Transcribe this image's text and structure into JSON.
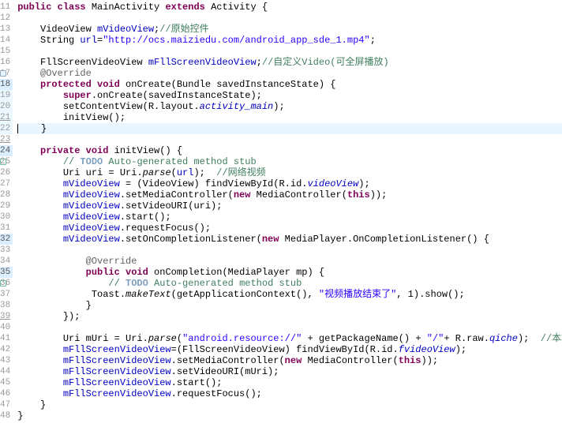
{
  "editor": {
    "first_line": 11,
    "last_line": 48,
    "highlighted_line": 22,
    "lines": {
      "11": [
        {
          "cls": "kw",
          "t": "public class"
        },
        {
          "cls": "plain",
          "t": " MainActivity "
        },
        {
          "cls": "kw",
          "t": "extends"
        },
        {
          "cls": "plain",
          "t": " Activity {"
        }
      ],
      "12": [
        {
          "cls": "plain",
          "t": ""
        }
      ],
      "13": [
        {
          "cls": "plain",
          "t": "    VideoView "
        },
        {
          "cls": "field",
          "t": "mVideoView"
        },
        {
          "cls": "plain",
          "t": ";"
        },
        {
          "cls": "cmt",
          "t": "//原始控件"
        }
      ],
      "14": [
        {
          "cls": "plain",
          "t": "    String "
        },
        {
          "cls": "field",
          "t": "url"
        },
        {
          "cls": "plain",
          "t": "="
        },
        {
          "cls": "str",
          "t": "\"http://ocs.maiziedu.com/android_app_sde_1.mp4\""
        },
        {
          "cls": "plain",
          "t": ";"
        }
      ],
      "15": [
        {
          "cls": "plain",
          "t": ""
        }
      ],
      "16": [
        {
          "cls": "plain",
          "t": "    FllScreenVideoView "
        },
        {
          "cls": "field",
          "t": "mFllScreenVideoView"
        },
        {
          "cls": "plain",
          "t": ";"
        },
        {
          "cls": "cmt",
          "t": "//自定义Video(可全屏播放)"
        }
      ],
      "17": [
        {
          "cls": "ann",
          "t": "    @Override"
        }
      ],
      "18": [
        {
          "cls": "plain",
          "t": "    "
        },
        {
          "cls": "kw",
          "t": "protected void"
        },
        {
          "cls": "plain",
          "t": " onCreate(Bundle savedInstanceState) {"
        }
      ],
      "19": [
        {
          "cls": "plain",
          "t": "        "
        },
        {
          "cls": "kw",
          "t": "super"
        },
        {
          "cls": "plain",
          "t": ".onCreate(savedInstanceState);"
        }
      ],
      "20": [
        {
          "cls": "plain",
          "t": "        setContentView(R.layout."
        },
        {
          "cls": "const-it",
          "t": "activity_main"
        },
        {
          "cls": "plain",
          "t": ");"
        }
      ],
      "21": [
        {
          "cls": "plain",
          "t": "        initView();"
        }
      ],
      "22": [
        {
          "cls": "plain",
          "t": "    }"
        }
      ],
      "23": [
        {
          "cls": "plain",
          "t": ""
        }
      ],
      "24": [
        {
          "cls": "plain",
          "t": "    "
        },
        {
          "cls": "kw",
          "t": "private void"
        },
        {
          "cls": "plain",
          "t": " initView() {"
        }
      ],
      "25": [
        {
          "cls": "plain",
          "t": "        "
        },
        {
          "cls": "cmt",
          "t": "// "
        },
        {
          "cls": "todo",
          "t": "TODO"
        },
        {
          "cls": "cmt",
          "t": " Auto-generated method stub"
        }
      ],
      "26": [
        {
          "cls": "plain",
          "t": "        Uri uri = Uri."
        },
        {
          "cls": "static-it",
          "t": "parse"
        },
        {
          "cls": "plain",
          "t": "("
        },
        {
          "cls": "field",
          "t": "url"
        },
        {
          "cls": "plain",
          "t": ");  "
        },
        {
          "cls": "cmt",
          "t": "//网络视频"
        }
      ],
      "27": [
        {
          "cls": "plain",
          "t": "        "
        },
        {
          "cls": "field",
          "t": "mVideoView"
        },
        {
          "cls": "plain",
          "t": " = (VideoView) findViewById(R.id."
        },
        {
          "cls": "const-it",
          "t": "videoView"
        },
        {
          "cls": "plain",
          "t": ");"
        }
      ],
      "28": [
        {
          "cls": "plain",
          "t": "        "
        },
        {
          "cls": "field",
          "t": "mVideoView"
        },
        {
          "cls": "plain",
          "t": ".setMediaController("
        },
        {
          "cls": "kw",
          "t": "new"
        },
        {
          "cls": "plain",
          "t": " MediaController("
        },
        {
          "cls": "kw",
          "t": "this"
        },
        {
          "cls": "plain",
          "t": "));"
        }
      ],
      "29": [
        {
          "cls": "plain",
          "t": "        "
        },
        {
          "cls": "field",
          "t": "mVideoView"
        },
        {
          "cls": "plain",
          "t": ".setVideoURI(uri);"
        }
      ],
      "30": [
        {
          "cls": "plain",
          "t": "        "
        },
        {
          "cls": "field",
          "t": "mVideoView"
        },
        {
          "cls": "plain",
          "t": ".start();"
        }
      ],
      "31": [
        {
          "cls": "plain",
          "t": "        "
        },
        {
          "cls": "field",
          "t": "mVideoView"
        },
        {
          "cls": "plain",
          "t": ".requestFocus();"
        }
      ],
      "32": [
        {
          "cls": "plain",
          "t": "        "
        },
        {
          "cls": "field",
          "t": "mVideoView"
        },
        {
          "cls": "plain",
          "t": ".setOnCompletionListener("
        },
        {
          "cls": "kw",
          "t": "new"
        },
        {
          "cls": "plain",
          "t": " MediaPlayer.OnCompletionListener() {"
        }
      ],
      "33": [
        {
          "cls": "plain",
          "t": ""
        }
      ],
      "34": [
        {
          "cls": "ann",
          "t": "            @Override"
        }
      ],
      "35": [
        {
          "cls": "plain",
          "t": "            "
        },
        {
          "cls": "kw",
          "t": "public void"
        },
        {
          "cls": "plain",
          "t": " onCompletion(MediaPlayer mp) {"
        }
      ],
      "36": [
        {
          "cls": "plain",
          "t": "                "
        },
        {
          "cls": "cmt",
          "t": "// "
        },
        {
          "cls": "todo",
          "t": "TODO"
        },
        {
          "cls": "cmt",
          "t": " Auto-generated method stub"
        }
      ],
      "37": [
        {
          "cls": "plain",
          "t": "             Toast."
        },
        {
          "cls": "static-it",
          "t": "makeText"
        },
        {
          "cls": "plain",
          "t": "(getApplicationContext(), "
        },
        {
          "cls": "str",
          "t": "\"视频播放结束了\""
        },
        {
          "cls": "plain",
          "t": ", 1).show();"
        }
      ],
      "38": [
        {
          "cls": "plain",
          "t": "            }"
        }
      ],
      "39": [
        {
          "cls": "plain",
          "t": "        });"
        }
      ],
      "40": [
        {
          "cls": "plain",
          "t": ""
        }
      ],
      "41": [
        {
          "cls": "plain",
          "t": "        Uri mUri = Uri."
        },
        {
          "cls": "static-it",
          "t": "parse"
        },
        {
          "cls": "plain",
          "t": "("
        },
        {
          "cls": "str",
          "t": "\"android.resource://\""
        },
        {
          "cls": "plain",
          "t": " + getPackageName() + "
        },
        {
          "cls": "str",
          "t": "\"/\""
        },
        {
          "cls": "plain",
          "t": "+ R.raw."
        },
        {
          "cls": "const-it",
          "t": "qiche"
        },
        {
          "cls": "plain",
          "t": ");  "
        },
        {
          "cls": "cmt",
          "t": "//本地视频"
        }
      ],
      "42": [
        {
          "cls": "plain",
          "t": "        "
        },
        {
          "cls": "field",
          "t": "mFllScreenVideoView"
        },
        {
          "cls": "plain",
          "t": "=(FllScreenVideoView) findViewById(R.id."
        },
        {
          "cls": "const-it",
          "t": "fvideoView"
        },
        {
          "cls": "plain",
          "t": ");"
        }
      ],
      "43": [
        {
          "cls": "plain",
          "t": "        "
        },
        {
          "cls": "field",
          "t": "mFllScreenVideoView"
        },
        {
          "cls": "plain",
          "t": ".setMediaController("
        },
        {
          "cls": "kw",
          "t": "new"
        },
        {
          "cls": "plain",
          "t": " MediaController("
        },
        {
          "cls": "kw",
          "t": "this"
        },
        {
          "cls": "plain",
          "t": "));"
        }
      ],
      "44": [
        {
          "cls": "plain",
          "t": "        "
        },
        {
          "cls": "field",
          "t": "mFllScreenVideoView"
        },
        {
          "cls": "plain",
          "t": ".setVideoURI(mUri);"
        }
      ],
      "45": [
        {
          "cls": "plain",
          "t": "        "
        },
        {
          "cls": "field",
          "t": "mFllScreenVideoView"
        },
        {
          "cls": "plain",
          "t": ".start();"
        }
      ],
      "46": [
        {
          "cls": "plain",
          "t": "        "
        },
        {
          "cls": "field",
          "t": "mFllScreenVideoView"
        },
        {
          "cls": "plain",
          "t": ".requestFocus();"
        }
      ],
      "47": [
        {
          "cls": "plain",
          "t": "    }"
        }
      ],
      "48": [
        {
          "cls": "plain",
          "t": "}"
        }
      ]
    },
    "gutter_marks": {
      "17": "ov",
      "18": "bp",
      "19": "bp2",
      "20": "bp2",
      "21": "bp2ul",
      "22": "bp2",
      "23": "ul",
      "24": "bp",
      "25": "mark",
      "32": "bp",
      "35": "bp",
      "36": "mark",
      "39": "ul"
    }
  }
}
